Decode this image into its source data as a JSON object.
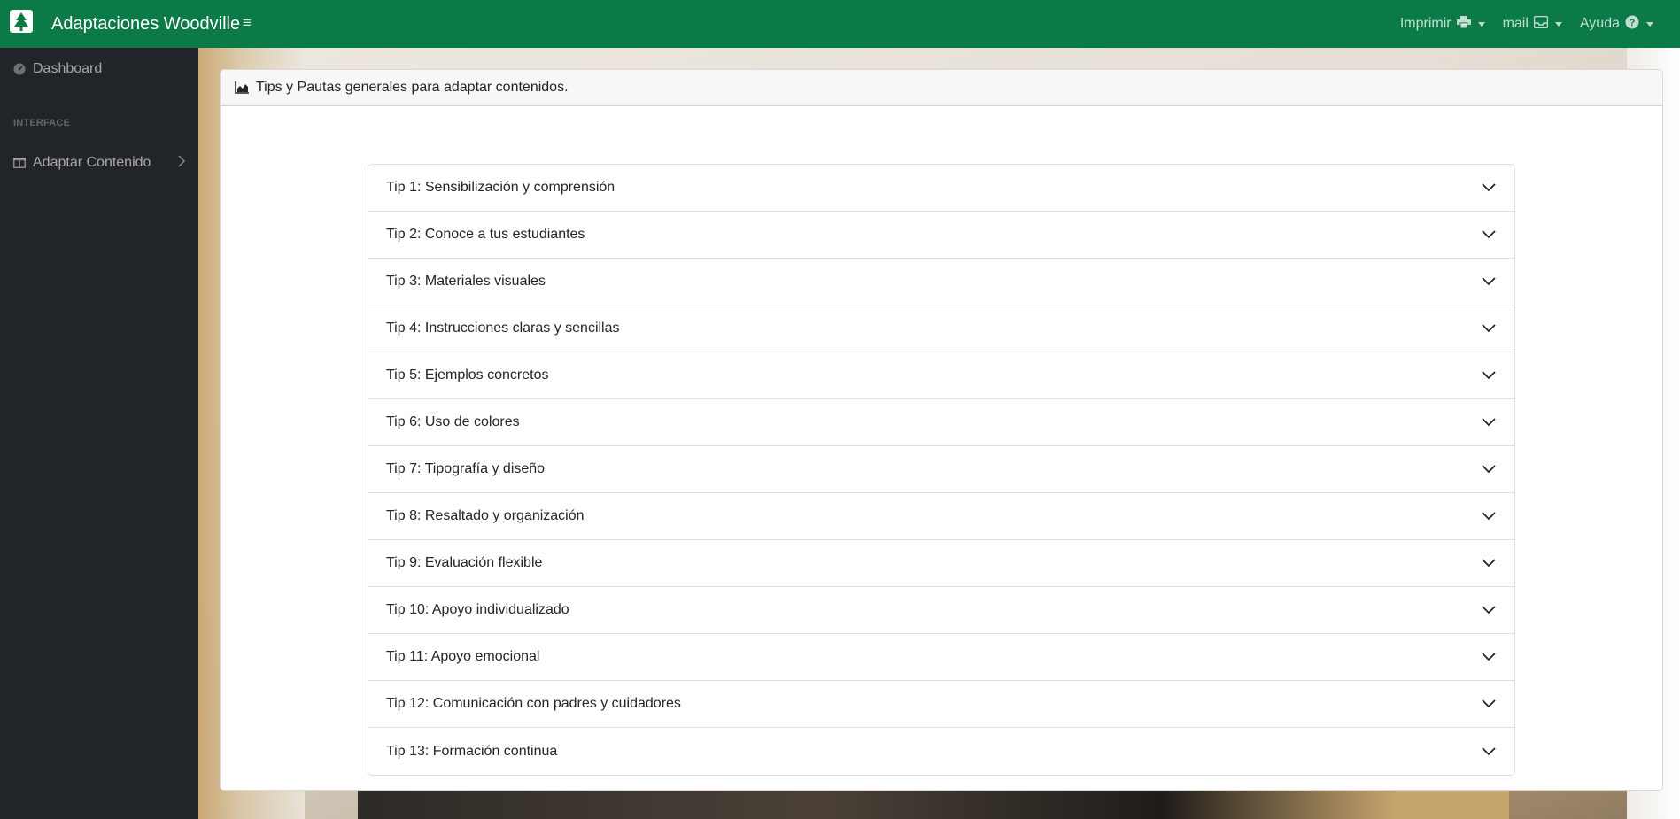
{
  "brand": {
    "title": "Adaptaciones Woodville",
    "logo_icon": "tree-icon",
    "menu_icon": "bars-icon"
  },
  "topnav": {
    "print": {
      "label": "Imprimir",
      "icon": "printer-icon"
    },
    "mail": {
      "label": "mail",
      "icon": "inbox-icon"
    },
    "help": {
      "label": "Ayuda",
      "icon": "question-circle-icon"
    }
  },
  "sidebar": {
    "dashboard": {
      "label": "Dashboard",
      "icon": "tachometer-icon"
    },
    "heading": "INTERFACE",
    "adapt": {
      "label": "Adaptar Contenido",
      "icon": "columns-icon"
    }
  },
  "card": {
    "header": "Tips y Pautas generales para adaptar contenidos.",
    "header_icon": "area-chart-icon"
  },
  "tips": [
    "Tip 1: Sensibilización y comprensión",
    "Tip 2: Conoce a tus estudiantes",
    "Tip 3: Materiales visuales",
    "Tip 4: Instrucciones claras y sencillas",
    "Tip 5: Ejemplos concretos",
    "Tip 6: Uso de colores",
    "Tip 7: Tipografía y diseño",
    "Tip 8: Resaltado y organización",
    "Tip 9: Evaluación flexible",
    "Tip 10: Apoyo individualizado",
    "Tip 11: Apoyo emocional",
    "Tip 12: Comunicación con padres y cuidadores",
    "Tip 13: Formación continua"
  ],
  "colors": {
    "topbar": "#0b7a47",
    "sidebar": "#212529"
  }
}
